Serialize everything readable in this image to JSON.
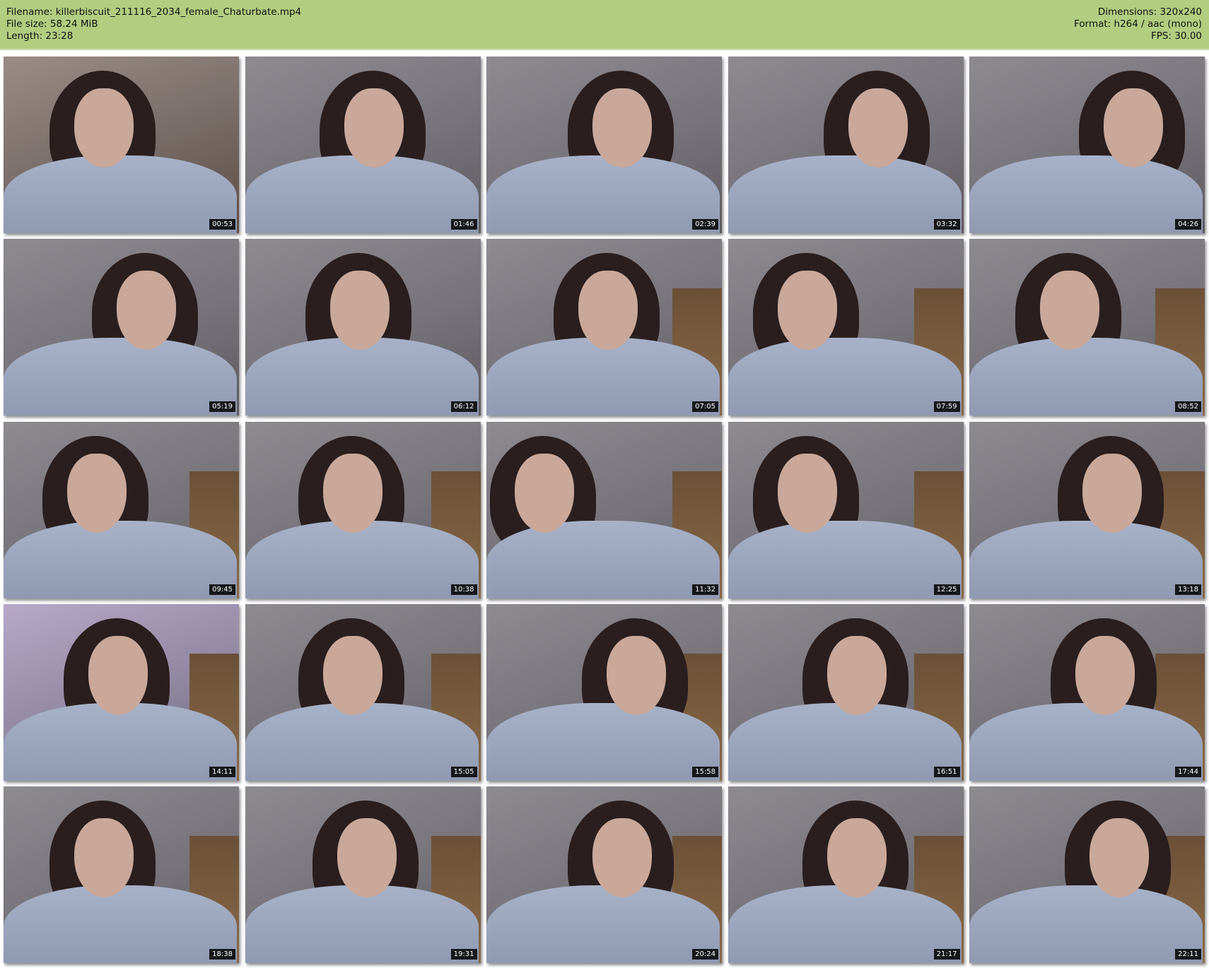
{
  "header": {
    "filename": "Filename: killerbiscuit_211116_2034_female_Chaturbate.mp4",
    "file_size": "File size: 58.24 MiB",
    "length": "Length: 23:28",
    "dimensions": "Dimensions: 320x240",
    "format": "Format: h264 / aac (mono)",
    "fps": "FPS: 30.00"
  },
  "colors": {
    "header_bg": "#b1cd80"
  },
  "thumbnails": [
    {
      "time": "00:53"
    },
    {
      "time": "01:46"
    },
    {
      "time": "02:39"
    },
    {
      "time": "03:32"
    },
    {
      "time": "04:26"
    },
    {
      "time": "05:19"
    },
    {
      "time": "06:12"
    },
    {
      "time": "07:05"
    },
    {
      "time": "07:59"
    },
    {
      "time": "08:52"
    },
    {
      "time": "09:45"
    },
    {
      "time": "10:38"
    },
    {
      "time": "11:32"
    },
    {
      "time": "12:25"
    },
    {
      "time": "13:18"
    },
    {
      "time": "14:11"
    },
    {
      "time": "15:05"
    },
    {
      "time": "15:58"
    },
    {
      "time": "16:51"
    },
    {
      "time": "17:44"
    },
    {
      "time": "18:38"
    },
    {
      "time": "19:31"
    },
    {
      "time": "20:24"
    },
    {
      "time": "21:17"
    },
    {
      "time": "22:11"
    }
  ]
}
